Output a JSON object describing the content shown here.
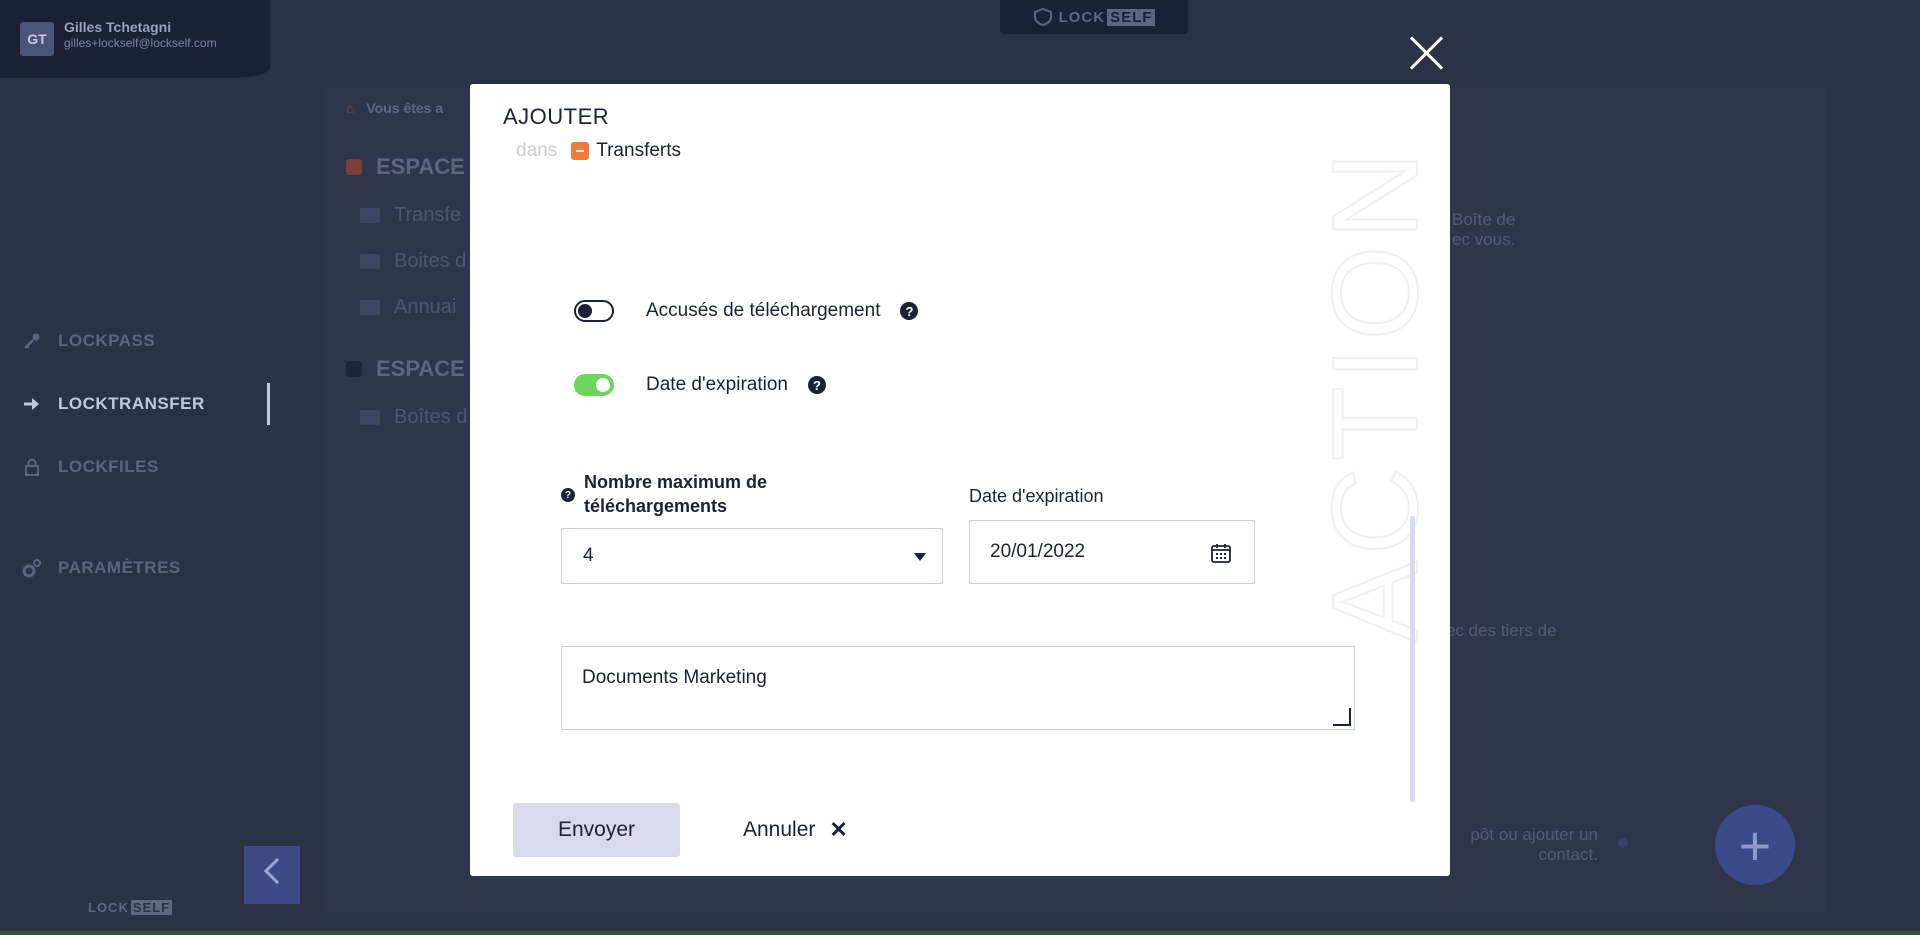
{
  "user": {
    "initials": "GT",
    "name": "Gilles Tchetagni",
    "email": "gilles+lockself@lockself.com"
  },
  "brand": {
    "logo_text": "LOCK",
    "logo_badge": "SELF"
  },
  "sidebar": {
    "items": [
      {
        "label": "LOCKPASS",
        "icon": "key-icon"
      },
      {
        "label": "LOCKTRANSFER",
        "icon": "arrow-right-icon",
        "active": true
      },
      {
        "label": "LOCKFILES",
        "icon": "lock-icon"
      },
      {
        "label": "PARAMÈTRES",
        "icon": "gear-icon"
      }
    ]
  },
  "background": {
    "breadcrumb": "Vous êtes a",
    "space1": {
      "title": "ESPACE",
      "folders": [
        "Transfe",
        "Boites d",
        "Annuai"
      ]
    },
    "space2": {
      "title": "ESPACE",
      "folders": [
        "Boîtes d"
      ]
    },
    "right_text_1": [
      "Boîte de",
      "ec vous."
    ],
    "right_text_2": "ec des tiers de",
    "right_text_3": [
      "pôt ou ajouter un",
      "contact."
    ]
  },
  "modal": {
    "title": "AJOUTER",
    "sub_prefix": "dans",
    "destination": "Transferts",
    "watermark": "ACTION",
    "toggles": [
      {
        "label": "Accusés de téléchargement",
        "on": false
      },
      {
        "label": "Date d'expiration",
        "on": true
      }
    ],
    "max_downloads": {
      "label": "Nombre maximum de téléchargements",
      "label_line1": "Nombre maximum de",
      "label_line2": "téléchargements",
      "value": "4"
    },
    "expiration": {
      "label": "Date d'expiration",
      "value": "20/01/2022"
    },
    "message": "Documents Marketing",
    "send_label": "Envoyer",
    "cancel_label": "Annuler"
  },
  "colors": {
    "accent_orange": "#f07b3b",
    "toggle_on": "#6fd45a",
    "dark": "#1d2233",
    "overlay": "#2b3246"
  }
}
